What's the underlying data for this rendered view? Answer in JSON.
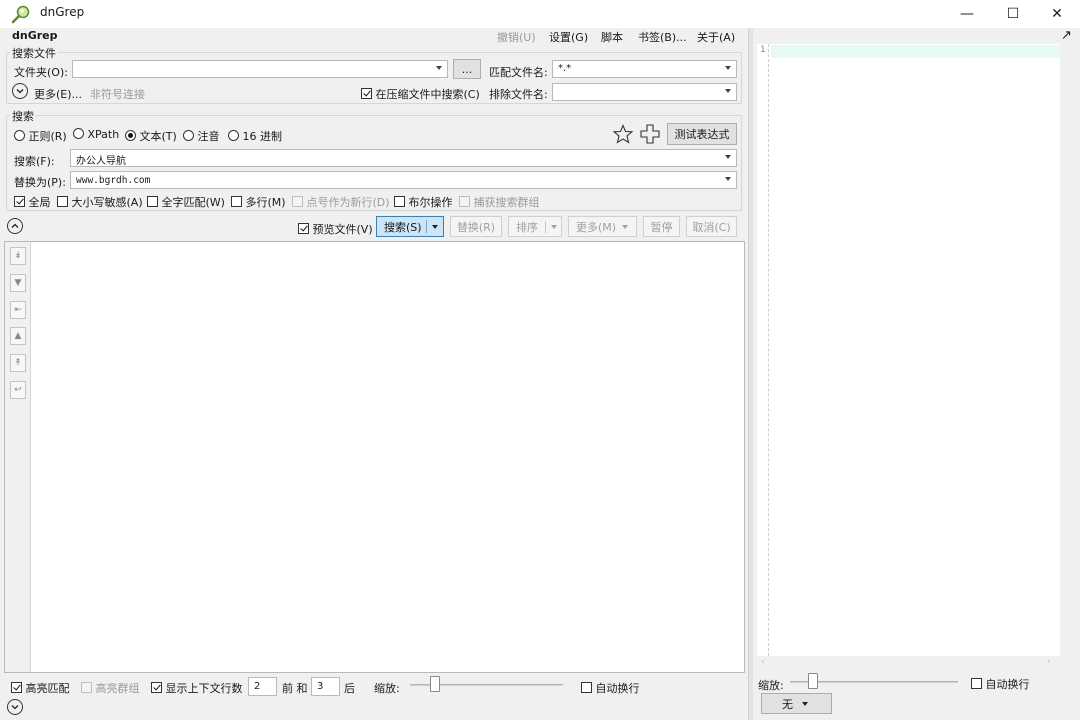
{
  "window": {
    "title": "dnGrep",
    "min_glyph": "—",
    "max_glyph": "☐",
    "close_glyph": "✕"
  },
  "menu": {
    "app_name": "dnGrep",
    "undo": "撤销(U)",
    "settings": "设置(G)",
    "script": "脚本",
    "bookmarks": "书签(B)...",
    "about": "关于(A)"
  },
  "search_files": {
    "group_label": "搜索文件",
    "folder_label": "文件夹(O):",
    "folder_value": "",
    "browse_label": "...",
    "match_files_label": "匹配文件名:",
    "match_files_value": "*.*",
    "more_label": "更多(E)...",
    "non_symbolic_label": "非符号连接",
    "archives_label": "在压缩文件中搜索(C)",
    "archives_checked": true,
    "exclude_files_label": "排除文件名:",
    "exclude_files_value": ""
  },
  "search": {
    "group_label": "搜索",
    "modes": [
      {
        "label": "正则(R)",
        "selected": false
      },
      {
        "label": "XPath",
        "selected": false
      },
      {
        "label": "文本(T)",
        "selected": true
      },
      {
        "label": "注音",
        "selected": false
      },
      {
        "label": "16 进制",
        "selected": false
      }
    ],
    "test_expression_label": "测试表达式",
    "search_for_label": "搜索(F):",
    "search_for_value": "办公人导航",
    "replace_with_label": "替换为(P):",
    "replace_with_value": "www.bgrdh.com",
    "options": [
      {
        "label": "全局",
        "checked": true,
        "disabled": false
      },
      {
        "label": "大小写敏感(A)",
        "checked": false,
        "disabled": false
      },
      {
        "label": "全字匹配(W)",
        "checked": false,
        "disabled": false
      },
      {
        "label": "多行(M)",
        "checked": false,
        "disabled": false
      },
      {
        "label": "点号作为新行(D)",
        "checked": false,
        "disabled": true
      },
      {
        "label": "布尔操作",
        "checked": false,
        "disabled": false
      },
      {
        "label": "捕获搜索群组",
        "checked": false,
        "disabled": true
      }
    ]
  },
  "actions": {
    "preview_label": "预览文件(V)",
    "preview_checked": true,
    "search_label": "搜索(S)",
    "replace_label": "替换(R)",
    "sort_label": "排序",
    "more_label": "更多(M)",
    "pause_label": "暂停",
    "cancel_label": "取消(C)"
  },
  "results_toolbar": {
    "icons": [
      "expand-all-icon",
      "next-file-icon",
      "next-match-icon",
      "prev-file-icon",
      "collapse-all-icon",
      "go-back-icon"
    ],
    "glyphs": [
      "↡",
      "▼",
      "⇤",
      "▲",
      "↟",
      "↩"
    ]
  },
  "bottom": {
    "highlight_label": "高亮匹配",
    "highlight_checked": true,
    "highlight_groups_label": "高亮群组",
    "show_context_label": "显示上下文行数",
    "show_context_checked": true,
    "before_value": "2",
    "before_label": "前 和",
    "after_value": "3",
    "after_label": "后",
    "zoom_label": "缩放:",
    "wrap_label": "自动换行"
  },
  "preview": {
    "line_numbers": [
      "1"
    ],
    "zoom_label": "缩放:",
    "wrap_label": "自动换行",
    "syntax_value": "无",
    "expand_glyph": "↗"
  }
}
